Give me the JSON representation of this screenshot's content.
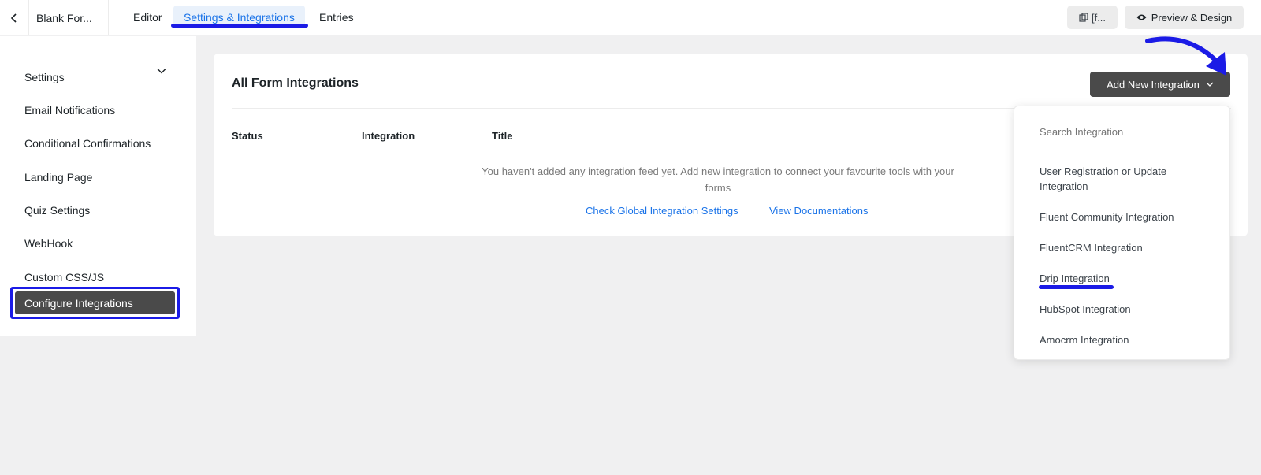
{
  "topbar": {
    "form_name": "Blank For...",
    "tabs": [
      {
        "label": "Editor"
      },
      {
        "label": "Settings & Integrations"
      },
      {
        "label": "Entries"
      }
    ],
    "shortcode_label": "[f...",
    "preview_label": "Preview & Design"
  },
  "sidebar": {
    "items": [
      {
        "label": "Settings"
      },
      {
        "label": "Email Notifications"
      },
      {
        "label": "Conditional Confirmations"
      },
      {
        "label": "Landing Page"
      },
      {
        "label": "Quiz Settings"
      },
      {
        "label": "WebHook"
      },
      {
        "label": "Custom CSS/JS"
      },
      {
        "label": "Configure Integrations"
      }
    ]
  },
  "main": {
    "title": "All Form Integrations",
    "add_button_label": "Add New Integration",
    "columns": [
      "Status",
      "Integration",
      "Title"
    ],
    "empty_message": "You haven't added any integration feed yet. Add new integration to connect your favourite tools with your forms",
    "links": [
      "Check Global Integration Settings",
      "View Documentations"
    ]
  },
  "dropdown": {
    "search_placeholder": "Search Integration",
    "items": [
      "User Registration or Update Integration",
      "Fluent Community Integration",
      "FluentCRM Integration",
      "Drip Integration",
      "HubSpot Integration",
      "Amocrm Integration"
    ]
  },
  "colors": {
    "accent": "#1a73e8",
    "annotation": "#1b1be6",
    "dark_button": "#4a4a4a"
  }
}
